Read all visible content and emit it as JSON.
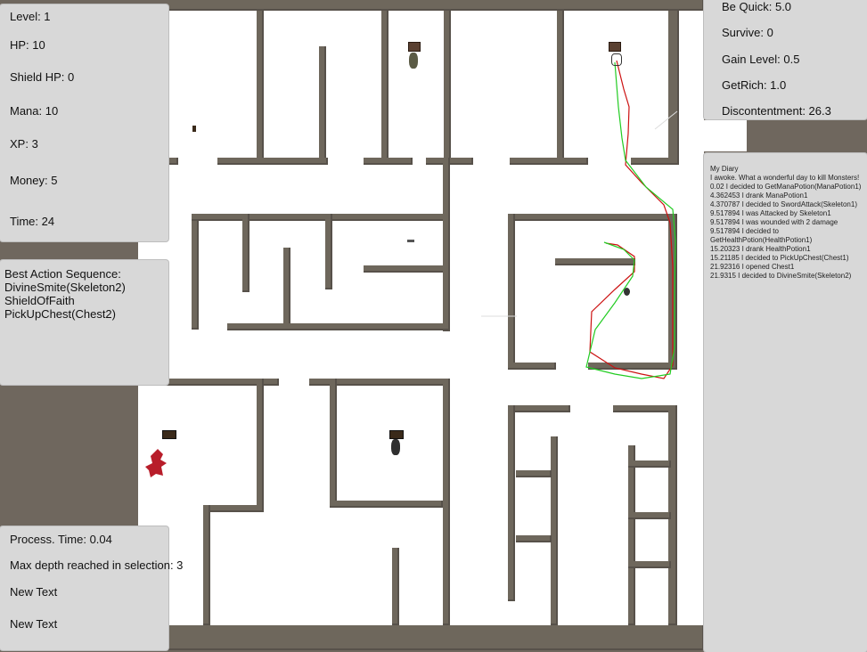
{
  "stats": {
    "level": "Level: 1",
    "hp": "HP: 10",
    "shield_hp": "Shield HP: 0",
    "mana": "Mana: 10",
    "xp": "XP: 3",
    "money": "Money: 5",
    "time": "Time: 24"
  },
  "goals": {
    "be_quick": "Be Quick: 5.0",
    "survive": "Survive: 0",
    "gain_level": "Gain Level: 0.5",
    "get_rich": "GetRich: 1.0",
    "discontentment": "Discontentment: 26.3"
  },
  "best_actions": {
    "title": "Best Action Sequence:",
    "items": [
      "DivineSmite(Skeleton2)",
      "ShieldOfFaith",
      "PickUpChest(Chest2)"
    ]
  },
  "process": {
    "process_time": "Process. Time: 0.04",
    "max_depth": "Max depth reached in selection: 3",
    "text1": "New Text",
    "text2": "New Text"
  },
  "diary": {
    "title": "My Diary",
    "entries": [
      " I awoke. What a wonderful day to kill Monsters!",
      "0.02 I decided to GetManaPotion(ManaPotion1)",
      "4.362453 I drank  ManaPotion1",
      "4.370787 I decided to SwordAttack(Skeleton1)",
      "9.517894 I was Attacked by Skeleton1",
      "9.517894 I was wounded with 2 damage",
      "9.517894 I decided to GetHealthPotion(HealthPotion1)",
      "15.20323 I drank  HealthPotion1",
      "15.21185 I decided to PickUpChest(Chest1)",
      "21.92316 I opened  Chest1",
      "21.9315 I decided to DivineSmite(Skeleton2)"
    ]
  },
  "colors": {
    "path_green": "#22cc22",
    "path_red": "#cc1111",
    "wall": "#6e675c",
    "panel": "#d8d8d8"
  }
}
